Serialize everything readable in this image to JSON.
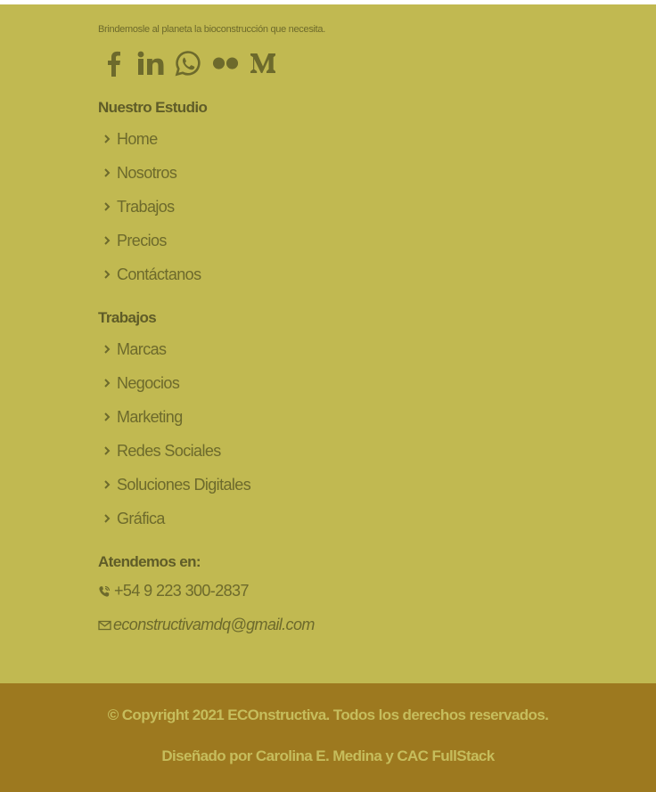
{
  "brand": {
    "name": "ECOnstructiva",
    "tagline": "Brindemosle al planeta la bioconstrucción que necesita."
  },
  "social": [
    {
      "name": "facebook-icon"
    },
    {
      "name": "linkedin-icon"
    },
    {
      "name": "whatsapp-icon"
    },
    {
      "name": "flickr-icon"
    },
    {
      "name": "medium-icon"
    }
  ],
  "studio": {
    "title": "Nuestro Estudio",
    "links": [
      "Home",
      "Nosotros",
      "Trabajos",
      "Precios",
      "Contáctanos"
    ]
  },
  "works": {
    "title": "Trabajos",
    "links": [
      "Marcas",
      "Negocios",
      "Marketing",
      "Redes Sociales",
      "Soluciones Digitales",
      "Gráfica"
    ]
  },
  "contact": {
    "title": "Atendemos en:",
    "phone": "+54 9 223 300-2837",
    "email": "econstructivamdq@gmail.com"
  },
  "footer": {
    "copyright": "© Copyright 2021 ECOnstructiva. Todos los derechos reservados.",
    "designed_by_prefix": "Diseñado por",
    "designer_name": "Carolina E. Medina",
    "conjunction": "y",
    "designer_team": "CAC FullStack"
  },
  "colors": {
    "background": "#c1b951",
    "footer_background": "#9d791f",
    "text": "#6d6a2c",
    "footer_text": "#c6bd5c"
  }
}
